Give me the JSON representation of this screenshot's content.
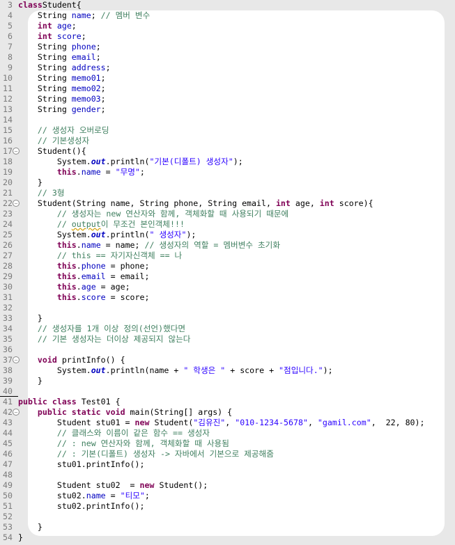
{
  "colors": {
    "keyword": "#7f0055",
    "field": "#0000c0",
    "string": "#2a00ff",
    "comment": "#3f7f5f",
    "background": "#e8e8e8"
  },
  "lines": [
    {
      "n": "3",
      "fold": false,
      "tokens": [
        [
          "kw",
          "class"
        ],
        [
          "",
          "Student{"
        ]
      ]
    },
    {
      "n": "4",
      "fold": false,
      "tokens": [
        [
          "",
          "    String "
        ],
        [
          "fld",
          "name"
        ],
        [
          "",
          "; "
        ],
        [
          "cm",
          "// 멤버 변수"
        ]
      ]
    },
    {
      "n": "5",
      "fold": false,
      "tokens": [
        [
          "",
          "    "
        ],
        [
          "kw",
          "int"
        ],
        [
          "",
          ""
        ],
        [
          "fld",
          " age"
        ],
        [
          "",
          ";"
        ]
      ]
    },
    {
      "n": "6",
      "fold": false,
      "tokens": [
        [
          "",
          "    "
        ],
        [
          "kw",
          "int"
        ],
        [
          "fld",
          " score"
        ],
        [
          "",
          ";"
        ]
      ]
    },
    {
      "n": "7",
      "fold": false,
      "tokens": [
        [
          "",
          "    String "
        ],
        [
          "fld",
          "phone"
        ],
        [
          "",
          ";"
        ]
      ]
    },
    {
      "n": "8",
      "fold": false,
      "tokens": [
        [
          "",
          "    String "
        ],
        [
          "fld",
          "email"
        ],
        [
          "",
          ";"
        ]
      ]
    },
    {
      "n": "9",
      "fold": false,
      "tokens": [
        [
          "",
          "    String "
        ],
        [
          "fld",
          "address"
        ],
        [
          "",
          ";"
        ]
      ]
    },
    {
      "n": "10",
      "fold": false,
      "tokens": [
        [
          "",
          "    String "
        ],
        [
          "fld",
          "memo01"
        ],
        [
          "",
          ";"
        ]
      ]
    },
    {
      "n": "11",
      "fold": false,
      "tokens": [
        [
          "",
          "    String "
        ],
        [
          "fld",
          "memo02"
        ],
        [
          "",
          ";"
        ]
      ]
    },
    {
      "n": "12",
      "fold": false,
      "tokens": [
        [
          "",
          "    String "
        ],
        [
          "fld",
          "memo03"
        ],
        [
          "",
          ";"
        ]
      ]
    },
    {
      "n": "13",
      "fold": false,
      "tokens": [
        [
          "",
          "    String "
        ],
        [
          "fld",
          "gender"
        ],
        [
          "",
          ";"
        ]
      ]
    },
    {
      "n": "14",
      "fold": false,
      "tokens": []
    },
    {
      "n": "15",
      "fold": false,
      "tokens": [
        [
          "",
          "    "
        ],
        [
          "cm",
          "// 생성자 오버로딩"
        ]
      ]
    },
    {
      "n": "16",
      "fold": false,
      "tokens": [
        [
          "",
          "    "
        ],
        [
          "cm",
          "// 기본생성자"
        ]
      ]
    },
    {
      "n": "17",
      "fold": true,
      "tokens": [
        [
          "",
          "    Student(){"
        ]
      ]
    },
    {
      "n": "18",
      "fold": false,
      "tokens": [
        [
          "",
          "        System."
        ],
        [
          "sf",
          "out"
        ],
        [
          "",
          ".println("
        ],
        [
          "str",
          "\"기본(디폴트) 생성자\""
        ],
        [
          "",
          ");"
        ]
      ]
    },
    {
      "n": "19",
      "fold": false,
      "tokens": [
        [
          "",
          "        "
        ],
        [
          "kw",
          "this"
        ],
        [
          "",
          "."
        ],
        [
          "fld",
          "name"
        ],
        [
          "",
          " = "
        ],
        [
          "str",
          "\"무명\""
        ],
        [
          "",
          ";"
        ]
      ]
    },
    {
      "n": "20",
      "fold": false,
      "tokens": [
        [
          "",
          "    }"
        ]
      ]
    },
    {
      "n": "21",
      "fold": false,
      "tokens": [
        [
          "",
          "    "
        ],
        [
          "cm",
          "// 3형"
        ]
      ]
    },
    {
      "n": "22",
      "fold": true,
      "tokens": [
        [
          "",
          "    Student(String name, String phone, String email, "
        ],
        [
          "kw",
          "int"
        ],
        [
          "",
          " age, "
        ],
        [
          "kw",
          "int"
        ],
        [
          "",
          " score){"
        ]
      ]
    },
    {
      "n": "23",
      "fold": false,
      "tokens": [
        [
          "",
          "        "
        ],
        [
          "cm",
          "// 생성자는 new 연산자와 함께, 객체화할 때 사용되기 때문에"
        ]
      ]
    },
    {
      "n": "24",
      "fold": false,
      "tokens": [
        [
          "",
          "        "
        ],
        [
          "cm",
          "// "
        ],
        [
          "cm warn",
          "output"
        ],
        [
          "cm",
          "이 무조건 본인객체!!!"
        ]
      ]
    },
    {
      "n": "25",
      "fold": false,
      "tokens": [
        [
          "",
          "        System."
        ],
        [
          "sf",
          "out"
        ],
        [
          "",
          ".println("
        ],
        [
          "str",
          "\" 생성자\""
        ],
        [
          "",
          ");"
        ]
      ]
    },
    {
      "n": "26",
      "fold": false,
      "tokens": [
        [
          "",
          "        "
        ],
        [
          "kw",
          "this"
        ],
        [
          "",
          "."
        ],
        [
          "fld",
          "name"
        ],
        [
          "",
          " = name; "
        ],
        [
          "cm",
          "// 생성자의 역할 = 멤버변수 초기화"
        ]
      ]
    },
    {
      "n": "27",
      "fold": false,
      "tokens": [
        [
          "",
          "        "
        ],
        [
          "cm",
          "// this == 자기자신객체 == 나"
        ]
      ]
    },
    {
      "n": "28",
      "fold": false,
      "tokens": [
        [
          "",
          "        "
        ],
        [
          "kw",
          "this"
        ],
        [
          "",
          "."
        ],
        [
          "fld",
          "phone"
        ],
        [
          "",
          " = phone;"
        ]
      ]
    },
    {
      "n": "29",
      "fold": false,
      "tokens": [
        [
          "",
          "        "
        ],
        [
          "kw",
          "this"
        ],
        [
          "",
          "."
        ],
        [
          "fld",
          "email"
        ],
        [
          "",
          " = email;"
        ]
      ]
    },
    {
      "n": "30",
      "fold": false,
      "tokens": [
        [
          "",
          "        "
        ],
        [
          "kw",
          "this"
        ],
        [
          "",
          "."
        ],
        [
          "fld",
          "age"
        ],
        [
          "",
          " = age;"
        ]
      ]
    },
    {
      "n": "31",
      "fold": false,
      "tokens": [
        [
          "",
          "        "
        ],
        [
          "kw",
          "this"
        ],
        [
          "",
          "."
        ],
        [
          "fld",
          "score"
        ],
        [
          "",
          " = score;"
        ]
      ]
    },
    {
      "n": "32",
      "fold": false,
      "tokens": []
    },
    {
      "n": "33",
      "fold": false,
      "tokens": [
        [
          "",
          "    }"
        ]
      ]
    },
    {
      "n": "34",
      "fold": false,
      "tokens": [
        [
          "",
          "    "
        ],
        [
          "cm",
          "// 생성자를 1개 이상 정의(선언)했다면"
        ]
      ]
    },
    {
      "n": "35",
      "fold": false,
      "tokens": [
        [
          "",
          "    "
        ],
        [
          "cm",
          "// 기본 생성자는 더이상 제공되지 않는다"
        ]
      ]
    },
    {
      "n": "36",
      "fold": false,
      "tokens": []
    },
    {
      "n": "37",
      "fold": true,
      "tokens": [
        [
          "",
          "    "
        ],
        [
          "kw",
          "void"
        ],
        [
          "",
          " printInfo() {"
        ]
      ]
    },
    {
      "n": "38",
      "fold": false,
      "tokens": [
        [
          "",
          "        System."
        ],
        [
          "sf",
          "out"
        ],
        [
          "",
          ".println(name + "
        ],
        [
          "str",
          "\" 학생은 \""
        ],
        [
          "",
          " + score + "
        ],
        [
          "str",
          "\"점입니다.\""
        ],
        [
          "",
          ");"
        ]
      ]
    },
    {
      "n": "39",
      "fold": false,
      "tokens": [
        [
          "",
          "    }"
        ]
      ]
    },
    {
      "n": "40",
      "fold": false,
      "tokens": []
    },
    {
      "n": "41",
      "fold": false,
      "tokens": [
        [
          "kw",
          "public class"
        ],
        [
          "",
          " Test01 {"
        ]
      ]
    },
    {
      "n": "42",
      "fold": true,
      "tokens": [
        [
          "",
          "    "
        ],
        [
          "kw",
          "public static void"
        ],
        [
          "",
          " main(String[] args) {"
        ]
      ]
    },
    {
      "n": "43",
      "fold": false,
      "tokens": [
        [
          "",
          "        Student stu01 = "
        ],
        [
          "kw",
          "new"
        ],
        [
          "",
          " Student("
        ],
        [
          "str",
          "\"김유진\""
        ],
        [
          "",
          ", "
        ],
        [
          "str",
          "\"010-1234-5678\""
        ],
        [
          "",
          ", "
        ],
        [
          "str",
          "\"gamil.com\""
        ],
        [
          "",
          ",  22, 80);"
        ]
      ]
    },
    {
      "n": "44",
      "fold": false,
      "tokens": [
        [
          "",
          "        "
        ],
        [
          "cm",
          "// 클래스와 이름이 같은 함수 == 생성자"
        ]
      ]
    },
    {
      "n": "45",
      "fold": false,
      "tokens": [
        [
          "",
          "        "
        ],
        [
          "cm",
          "// : new 연산자와 함께, 객체화할 때 사용됨"
        ]
      ]
    },
    {
      "n": "46",
      "fold": false,
      "tokens": [
        [
          "",
          "        "
        ],
        [
          "cm",
          "// : 기본(디폴트) 생성자 -> 자바에서 기본으로 제공해줌"
        ]
      ]
    },
    {
      "n": "47",
      "fold": false,
      "tokens": [
        [
          "",
          "        stu01.printInfo();"
        ]
      ]
    },
    {
      "n": "48",
      "fold": false,
      "tokens": []
    },
    {
      "n": "49",
      "fold": false,
      "tokens": [
        [
          "",
          "        Student stu02  = "
        ],
        [
          "kw",
          "new"
        ],
        [
          "",
          " Student();"
        ]
      ]
    },
    {
      "n": "50",
      "fold": false,
      "tokens": [
        [
          "",
          "        stu02."
        ],
        [
          "fld",
          "name"
        ],
        [
          "",
          " = "
        ],
        [
          "str",
          "\"티모\""
        ],
        [
          "",
          ";"
        ]
      ]
    },
    {
      "n": "51",
      "fold": false,
      "tokens": [
        [
          "",
          "        stu02.printInfo();"
        ]
      ]
    },
    {
      "n": "52",
      "fold": false,
      "tokens": []
    },
    {
      "n": "53",
      "fold": false,
      "tokens": [
        [
          "",
          "    }"
        ]
      ]
    },
    {
      "n": "54",
      "fold": false,
      "tokens": [
        [
          "",
          "}"
        ]
      ]
    }
  ],
  "line39_close": "}",
  "fold_symbol": "⊖"
}
